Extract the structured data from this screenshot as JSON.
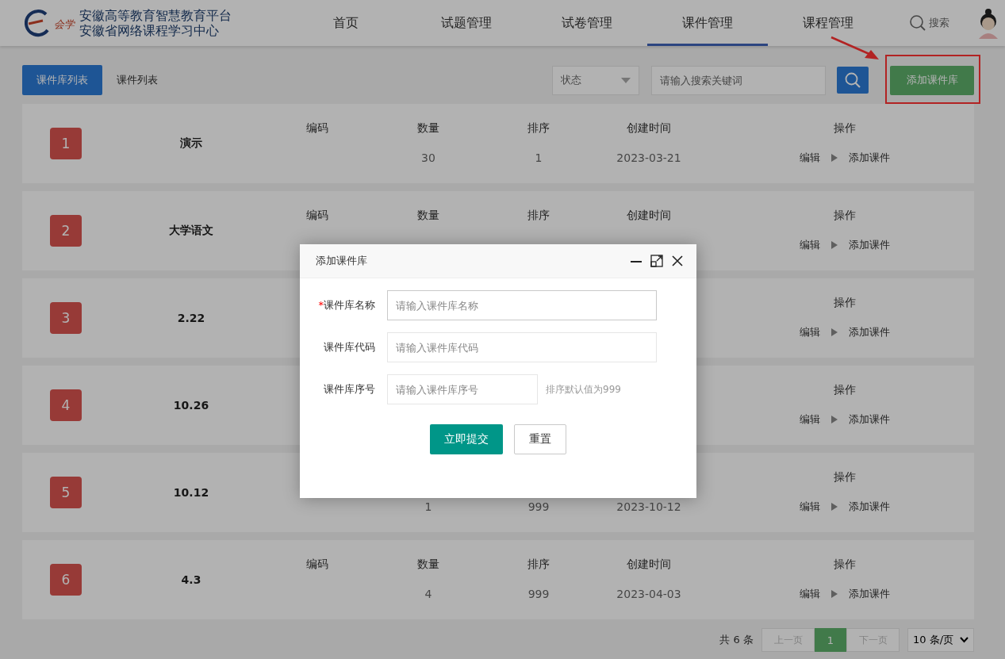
{
  "header": {
    "logo_mark": "会学",
    "logo_title": "安徽高等教育智慧教育平台",
    "logo_subtitle": "安徽省网络课程学习中心",
    "nav": [
      {
        "label": "首页",
        "selected": false
      },
      {
        "label": "试题管理",
        "selected": false
      },
      {
        "label": "试卷管理",
        "selected": false
      },
      {
        "label": "课件管理",
        "selected": true
      },
      {
        "label": "课程管理",
        "selected": false
      }
    ],
    "search_label": "搜索"
  },
  "toolbar": {
    "tabs": [
      {
        "label": "课件库列表",
        "selected": true
      },
      {
        "label": "课件列表",
        "selected": false
      }
    ],
    "status_select": "状态",
    "search": {
      "placeholder": "请输入搜索关键词"
    },
    "add_button": "添加课件库"
  },
  "rows": [
    {
      "number": "1",
      "name": "演示",
      "code_header": "编码",
      "count_header": "数量",
      "sort_header": "排序",
      "created_header": "创建时间",
      "actions_header": "操作",
      "count": "30",
      "sort": "1",
      "created": "2023-03-21",
      "edit": "编辑",
      "add": "添加课件"
    },
    {
      "number": "2",
      "name": "大学语文",
      "code_header": "编码",
      "count_header": "数量",
      "sort_header": "排序",
      "created_header": "创建时间",
      "actions_header": "操作",
      "edit": "编辑",
      "add": "添加课件"
    },
    {
      "number": "3",
      "name": "2.22",
      "actions_header": "操作",
      "edit": "编辑",
      "add": "添加课件"
    },
    {
      "number": "4",
      "name": "10.26",
      "actions_header": "操作",
      "edit": "编辑",
      "add": "添加课件"
    },
    {
      "number": "5",
      "name": "10.12",
      "actions_header": "操作",
      "count": "1",
      "sort": "999",
      "created": "2023-10-12",
      "edit": "编辑",
      "add": "添加课件"
    },
    {
      "number": "6",
      "name": "4.3",
      "code_header": "编码",
      "count_header": "数量",
      "sort_header": "排序",
      "created_header": "创建时间",
      "actions_header": "操作",
      "count": "4",
      "sort": "999",
      "created": "2023-04-03",
      "edit": "编辑",
      "add": "添加课件"
    }
  ],
  "pagination": {
    "total": "共 6 条",
    "prev": {
      "label": "上一页",
      "disabled": true
    },
    "pages": [
      {
        "label": "1",
        "selected": true
      }
    ],
    "next": {
      "label": "下一页",
      "disabled": true
    },
    "page_size": "10 条/页"
  },
  "dialog": {
    "title": "添加课件库",
    "fields": [
      {
        "label": "课件库名称",
        "required_mark": "*",
        "placeholder": "请输入课件库名称",
        "wide": true
      },
      {
        "label": "课件库代码",
        "placeholder": "请输入课件库代码",
        "wide": true
      },
      {
        "label": "课件库序号",
        "placeholder": "请输入课件库序号",
        "wide": false,
        "hint": "排序默认值为999"
      }
    ],
    "submit": "立即提交",
    "reset": "重置"
  }
}
